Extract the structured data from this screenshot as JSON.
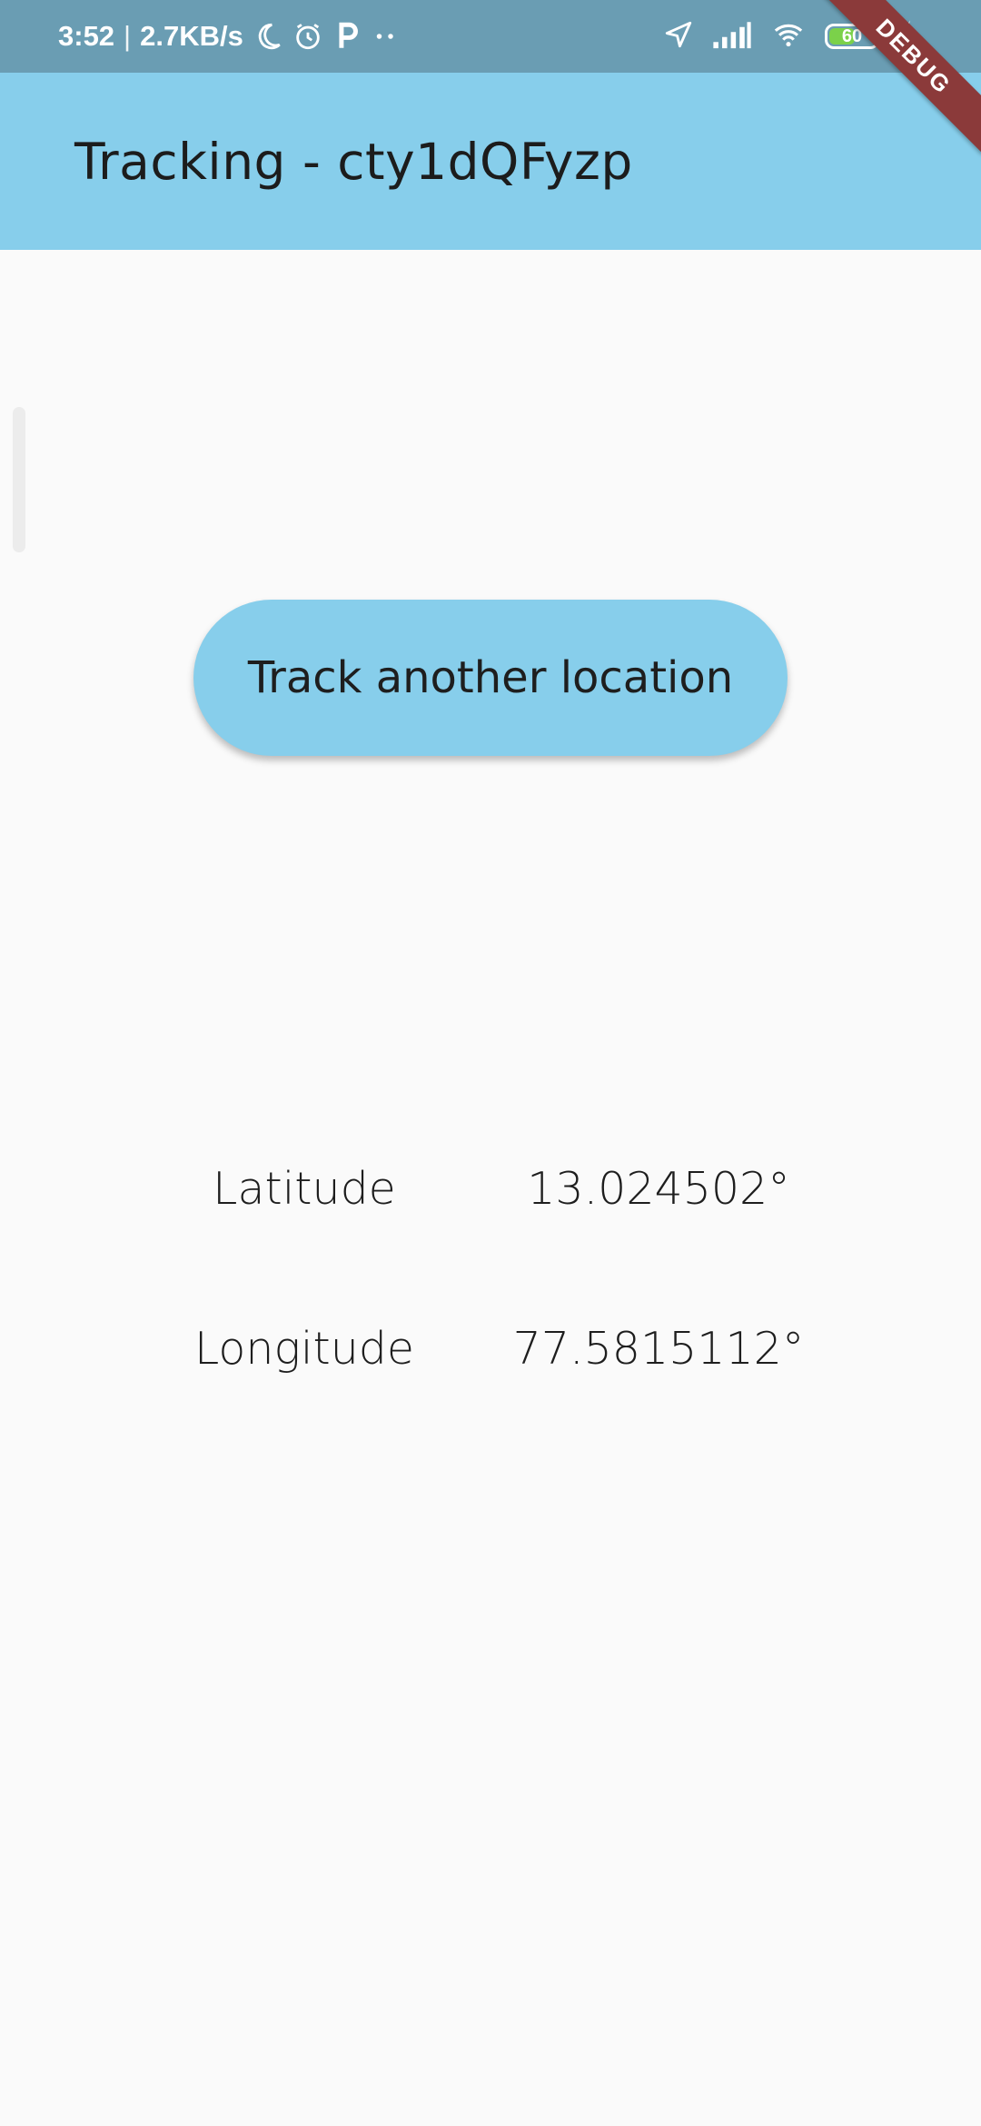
{
  "status_bar": {
    "time": "3:52",
    "separator": "|",
    "net_speed": "2.7KB/s",
    "battery_level": "60",
    "battery_fraction": 0.6,
    "icons": [
      "moon-icon",
      "alarm-icon",
      "parking-app-icon",
      "more-dots-icon",
      "location-arrow-icon",
      "signal-icon",
      "wifi-icon",
      "battery-icon",
      "charging-bolt-icon"
    ]
  },
  "debug_banner": "DEBUG",
  "app_bar": {
    "title": "Tracking - cty1dQFyzp"
  },
  "main": {
    "track_button_label": "Track another location",
    "latitude_label": "Latitude",
    "latitude_value": "13.024502°",
    "longitude_label": "Longitude",
    "longitude_value": "77.5815112°"
  },
  "colors": {
    "app_bar": "#87ceeb",
    "status_bar": "#6a9db3",
    "button": "#87ceeb",
    "background": "#fafafa",
    "debug_banner": "#8b3a3a"
  }
}
